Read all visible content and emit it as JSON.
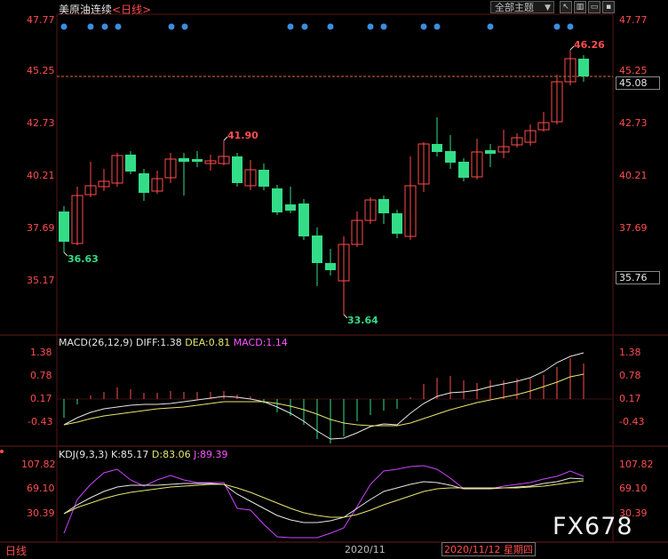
{
  "header": {
    "symbol": "美原油连续",
    "period": "<日线>",
    "theme_select": "全部主题",
    "buttons": [
      "↖",
      "▥",
      "▭"
    ]
  },
  "colors": {
    "up": "#ff4d4d",
    "down": "#33dd88",
    "grid": "#5a1414",
    "dash": "#e07030"
  },
  "main_chart": {
    "yticks": [
      "47.77",
      "45.25",
      "42.73",
      "40.21",
      "37.69",
      "35.17"
    ],
    "right_ticks": [
      "47.77",
      "45.25",
      "42.73",
      "40.21",
      "37.69"
    ],
    "current_price": "45.08",
    "low_box": "35.76",
    "annotations": {
      "high_left": "41.90",
      "low_left": "36.63",
      "low_main": "33.64",
      "high_right": "46.26"
    }
  },
  "macd": {
    "label": "MACD(26,12,9)",
    "diff": "DIFF:1.38",
    "dea": "DEA:0.81",
    "macd": "MACD:1.14",
    "yticks": [
      "1.38",
      "0.78",
      "0.17",
      "-0.43"
    ]
  },
  "kdj": {
    "label": "KDJ(9,3,3)",
    "k": "K:85.17",
    "d": "D:83.06",
    "j": "J:89.39",
    "yticks": [
      "107.82",
      "69.10",
      "30.39"
    ]
  },
  "footer": {
    "period_tab": "日线",
    "x_label": "2020/11",
    "cursor_date": "2020/11/12 星期四"
  },
  "watermark": "FX678"
}
